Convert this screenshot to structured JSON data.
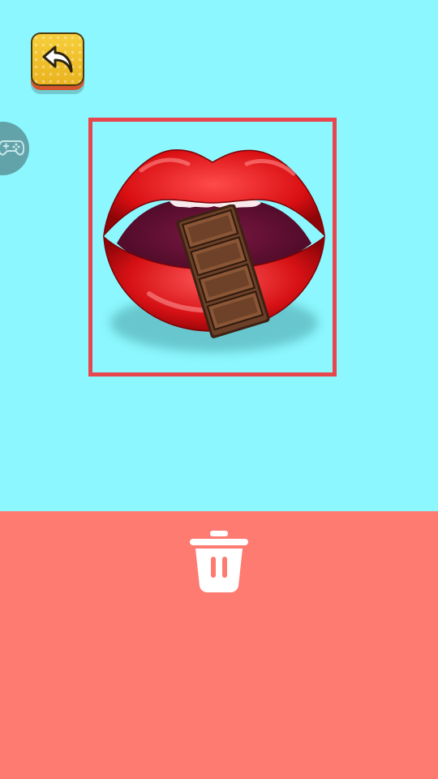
{
  "colors": {
    "play_background": "#8cf7fe",
    "trash_zone_background": "#fe7b72",
    "selection_frame": "#e8454d",
    "back_button": "#f2c42f",
    "trash_icon": "#ffffff"
  },
  "icons": {
    "back": "undo-arrow-icon",
    "gamepad": "gamepad-icon",
    "trash": "trash-can-icon"
  },
  "items": [
    {
      "name": "lips-with-chocolate-bar",
      "selected": true
    }
  ]
}
